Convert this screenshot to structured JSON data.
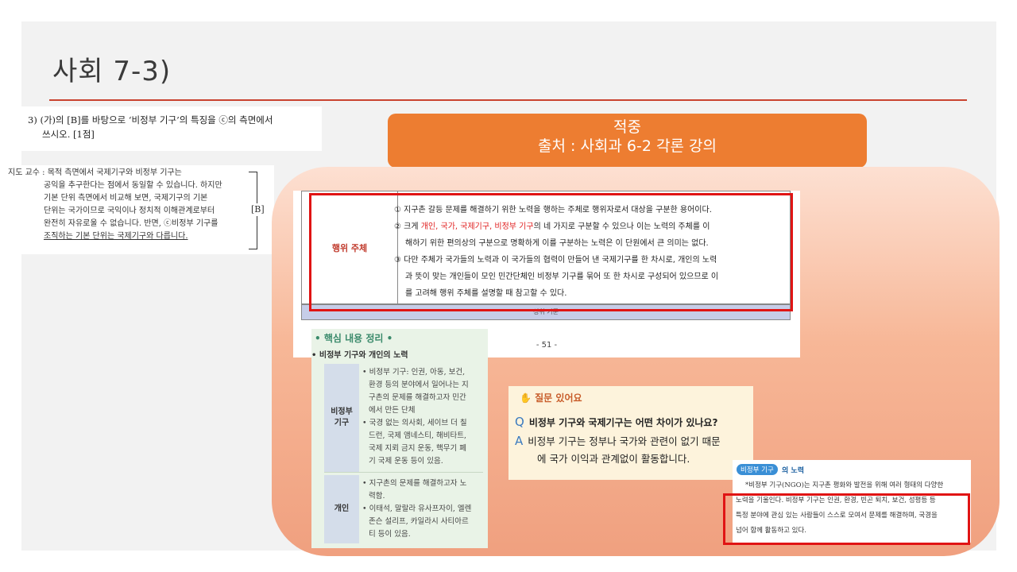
{
  "title": "사회 7-3)",
  "question": {
    "line1": "3) (가)의 [B]를 바탕으로 ‘비정부 기구’의 특징을 ⓒ의 측면에서",
    "line2": "쓰시오. [1점]"
  },
  "professor": {
    "lines": [
      "지도 교수 : 목적 측면에서 국제기구와 비정부 기구는",
      "공익을 추구한다는 점에서 동일할 수 있습니다. 하지만",
      "기본 단위 측면에서 비교해 보면, 국제기구의 기본",
      "단위는 국가이므로 국익이나 정치적 이해관계로부터",
      "완전히 자유로울 수 없습니다. 반면, ⓒ비정부 기구를",
      "조직하는 기본 단위는 국제기구와 다릅니다."
    ],
    "bracket_label": "[B]"
  },
  "banner": {
    "line1": "적중",
    "line2": "출처 : 사회과 6-2 각론 강의"
  },
  "doc": {
    "label": "행위 주체",
    "items": [
      {
        "a": "① 지구촌 갈등 문제를 해결하기 위한 노력을 행하는 주체로 행위자로서 대상을 구분한 용어이다.",
        "b": ""
      },
      {
        "pre": "② 크게 ",
        "red": "개인, 국가, 국제기구, 비정부 기구",
        "post": "의 네 가지로 구분할 수 있으나 이는 노력의 주체를 이",
        "b": "해하기 위한 편의상의 구분으로 명확하게 이를 구분하는 노력은 이 단원에서 큰 의미는 없다."
      },
      {
        "a": "③ 다만 주체가 국가들의 노력과 이 국가들의 협력이 만들어 낸 국제기구를 한 차시로, 개인의 노력",
        "b": "과 뜻이 맞는 개인들이 모인 민간단체인 비정부 기구를 묶어 또 한 차시로 구성되어 있으므로 이",
        "c": "를 고려해 행위 주체를 설명할 때 참고할 수 있다."
      }
    ],
    "band": "성취 기준",
    "page": "- 51 -"
  },
  "summary": {
    "heading": "• 핵심 내용 정리 •",
    "sub": "• 비정부 기구와 개인의 노력",
    "rows": [
      {
        "label": "비정부\n기구",
        "lines": [
          "• 비정부 기구: 인권, 아동, 보건,",
          "환경 등의 분야에서 일어나는 지",
          "구촌의 문제를 해결하고자 민간",
          "에서 만든 단체",
          "• 국경 없는 의사회, 세이브 더 칠",
          "드런, 국제 앰네스티, 해비타트,",
          "국제 지뢰 금지 운동, 핵무기 폐",
          "기 국제 운동 등이 있음."
        ]
      },
      {
        "label": "개인",
        "lines": [
          "• 지구촌의 문제를 해결하고자 노",
          "력함.",
          "• 이태석, 말랄라 유사프자이, 엘렌",
          "존슨 설리프, 카일라시 사티아르",
          "티 등이 있음."
        ]
      }
    ]
  },
  "qa": {
    "heading": "질문 있어요",
    "q_letter": "Q",
    "question": "비정부 기구와 국제기구는 어떤 차이가 있나요?",
    "a_letter": "A",
    "answer1": "비정부 기구는 정부나 국가와 관련이 없기 때문",
    "answer2": "에 국가 이익과 관계없이 활동합니다."
  },
  "ngo": {
    "tag": "비정부 기구",
    "tag_suffix": "의 노력",
    "lines": [
      "*비정부 기구(NGO)는 지구촌 평화와 발전을 위해 여러 형태의 다양한",
      "노력을 기울인다. 비정부 기구는 인권, 환경, 빈곤 퇴치, 보건, 성평등 등",
      "특정 분야에 관심 있는 사람들이 스스로 모여서 문제를 해결하며, 국경을",
      "넘어 함께 활동하고 있다."
    ]
  },
  "colors": {
    "accent_rule": "#c9432f",
    "banner": "#ed7d31",
    "highlight_box": "#e01414"
  }
}
